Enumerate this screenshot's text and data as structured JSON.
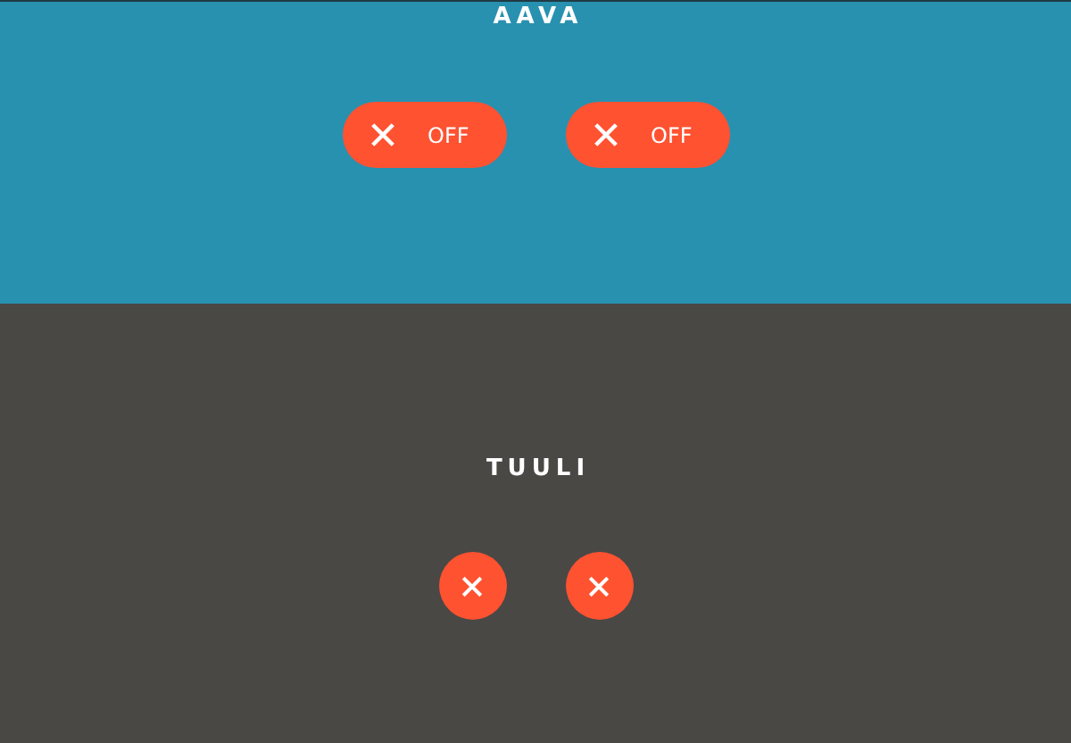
{
  "sections": [
    {
      "title": "AAVA",
      "kind": "pill",
      "toggles": [
        {
          "on": false,
          "label": "OFF"
        },
        {
          "on": false,
          "label": "OFF"
        }
      ]
    },
    {
      "title": "TUULI",
      "kind": "round",
      "toggles": [
        {
          "on": false
        },
        {
          "on": false
        }
      ]
    }
  ]
}
